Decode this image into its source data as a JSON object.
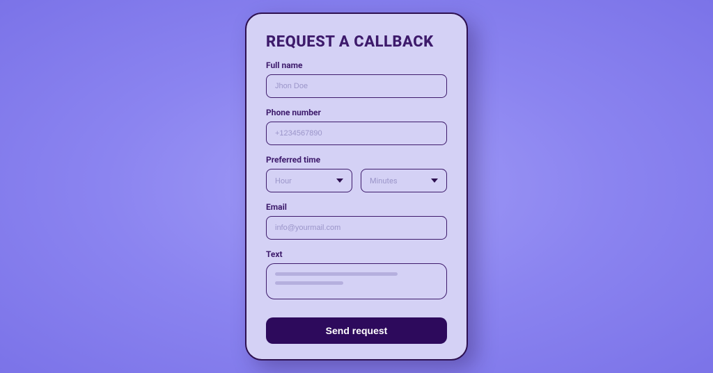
{
  "form": {
    "title": "REQUEST A CALLBACK",
    "fullName": {
      "label": "Full name",
      "placeholder": "Jhon Doe"
    },
    "phone": {
      "label": "Phone number",
      "placeholder": "+1234567890"
    },
    "preferredTime": {
      "label": "Preferred time",
      "hourPlaceholder": "Hour",
      "minutesPlaceholder": "Minutes"
    },
    "email": {
      "label": "Email",
      "placeholder": "info@yourmail.com"
    },
    "text": {
      "label": "Text"
    },
    "submitLabel": "Send request"
  }
}
